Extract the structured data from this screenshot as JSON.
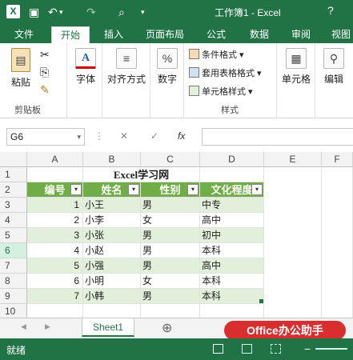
{
  "window": {
    "title": "工作簿1 - Excel",
    "app_icon": "X",
    "help": "?",
    "undo_symbol": "↶",
    "redo_symbol": "↷",
    "save_symbol": "▣",
    "print_symbol": "⌕",
    "customize_symbol": "▾"
  },
  "tabs": [
    {
      "label": "文件",
      "active": false
    },
    {
      "label": "开始",
      "active": true
    },
    {
      "label": "插入",
      "active": false
    },
    {
      "label": "页面布局",
      "active": false
    },
    {
      "label": "公式",
      "active": false
    },
    {
      "label": "数据",
      "active": false
    },
    {
      "label": "审阅",
      "active": false
    },
    {
      "label": "视图",
      "active": false
    }
  ],
  "ribbon": {
    "clipboard": {
      "paste": "粘贴",
      "group": "剪贴板",
      "paste_icon": "▤",
      "cut_icon": "✂",
      "copy_icon": "⎘",
      "brush_icon": "✎"
    },
    "font": {
      "label": "字体",
      "icon": "A"
    },
    "align": {
      "label": "对齐方式",
      "icon": "≡"
    },
    "number": {
      "label": "数字",
      "icon": "%"
    },
    "styles": {
      "conditional": "条件格式",
      "table": "套用表格格式",
      "cell": "单元格样式",
      "group": "样式"
    },
    "cells": {
      "label": "单元格",
      "icon": "▦"
    },
    "editing": {
      "label": "编辑",
      "icon": "⚲"
    }
  },
  "formula_bar": {
    "name_box": "G6",
    "cancel": "✕",
    "enter": "✓",
    "fx": "fx",
    "dropdown": "▾"
  },
  "grid": {
    "columns": [
      "A",
      "B",
      "C",
      "D",
      "E",
      "F"
    ],
    "rows": [
      "1",
      "2",
      "3",
      "4",
      "5",
      "6",
      "7",
      "8",
      "9",
      "10"
    ],
    "selected_row": "6",
    "title": "Excel学习网",
    "headers": [
      "编号",
      "姓名",
      "性别",
      "文化程度"
    ],
    "filter_symbol": "▾",
    "records": [
      {
        "id": "1",
        "name": "小王",
        "gender": "男",
        "edu": "中专"
      },
      {
        "id": "2",
        "name": "小李",
        "gender": "女",
        "edu": "高中"
      },
      {
        "id": "3",
        "name": "小张",
        "gender": "男",
        "edu": "初中"
      },
      {
        "id": "4",
        "name": "小赵",
        "gender": "男",
        "edu": "本科"
      },
      {
        "id": "5",
        "name": "小强",
        "gender": "男",
        "edu": "高中"
      },
      {
        "id": "6",
        "name": "小明",
        "gender": "女",
        "edu": "本科"
      },
      {
        "id": "7",
        "name": "小韩",
        "gender": "男",
        "edu": "本科"
      }
    ]
  },
  "sheets": {
    "active": "Sheet1",
    "add": "⊕",
    "prev": "◀",
    "next": "▶"
  },
  "status": {
    "text": "就绪"
  },
  "watermark": {
    "text": "Office办公助手"
  },
  "colors": {
    "accent": "#217346",
    "table_header": "#70ad47",
    "band": "#e2efda"
  }
}
